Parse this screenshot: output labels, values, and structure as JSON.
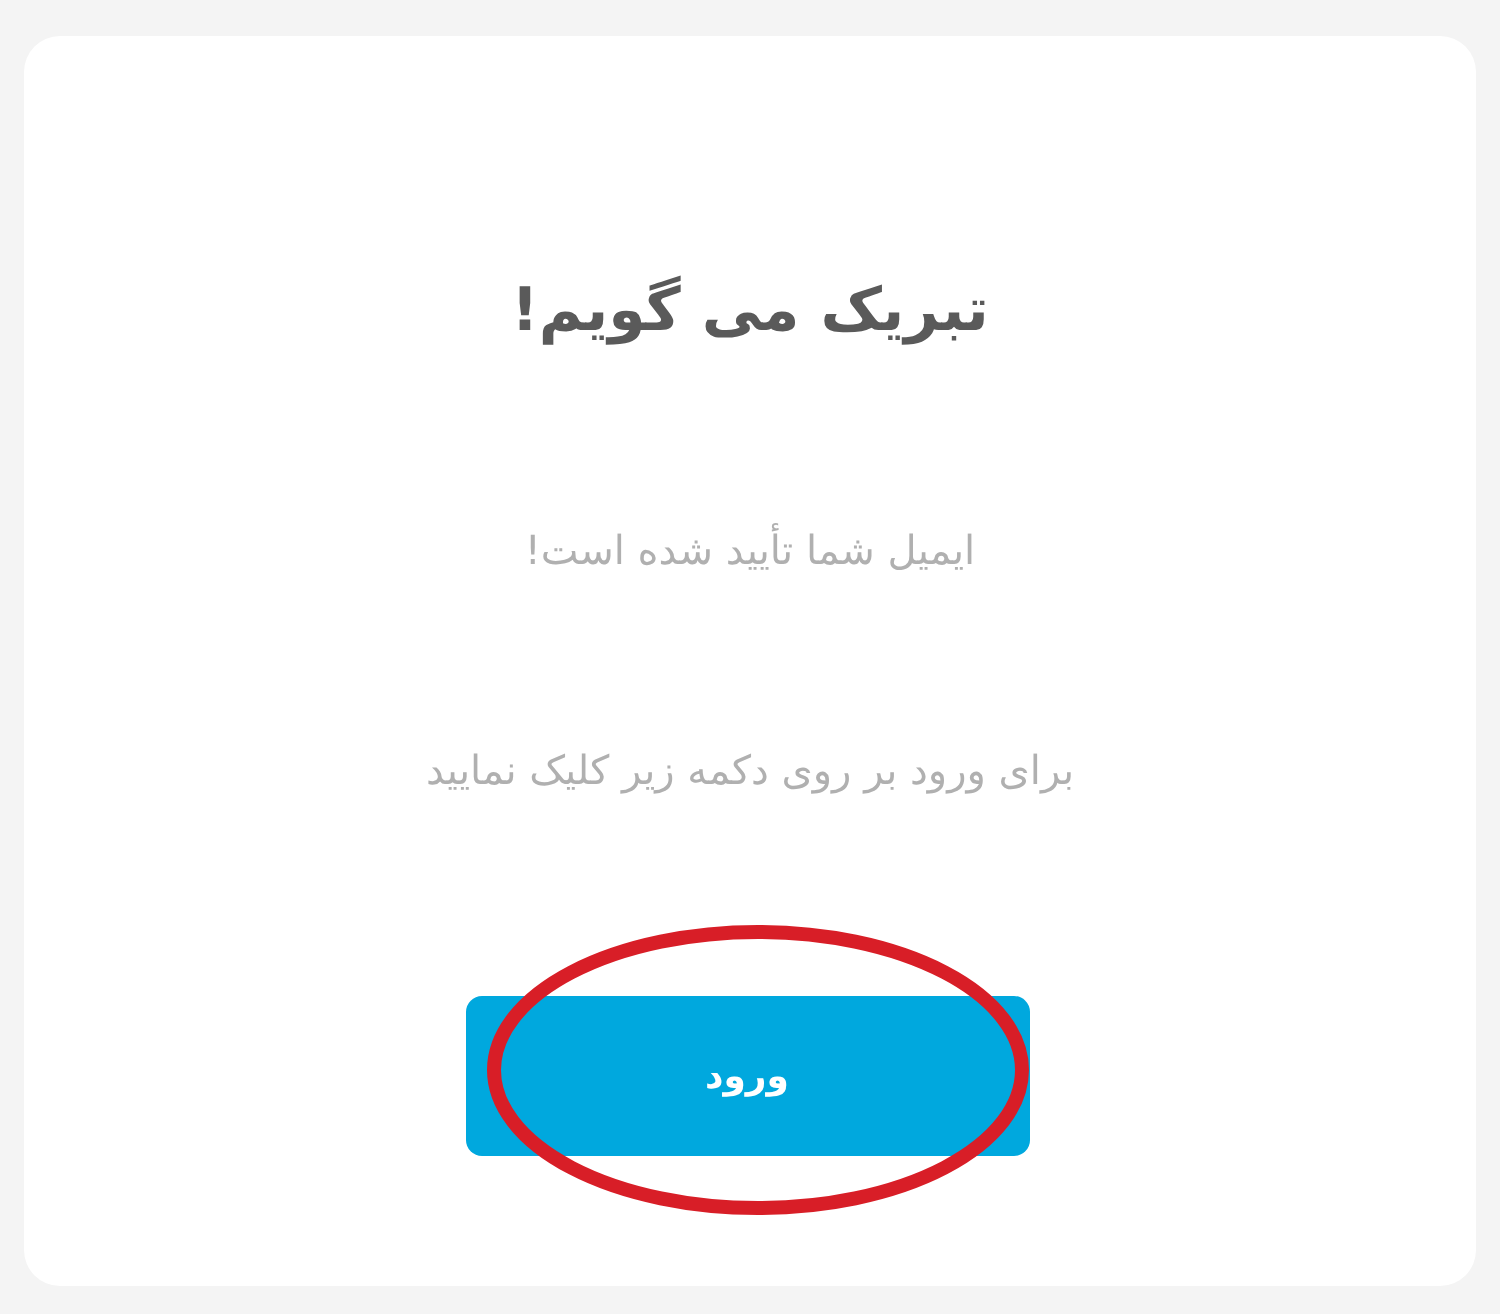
{
  "card": {
    "title": "تبریک می گویم!",
    "message": "ایمیل شما تأیید شده است!",
    "instruction": "برای ورود بر روی دکمه زیر کلیک نمایید",
    "button": {
      "label": "ورود",
      "circled": true
    }
  }
}
